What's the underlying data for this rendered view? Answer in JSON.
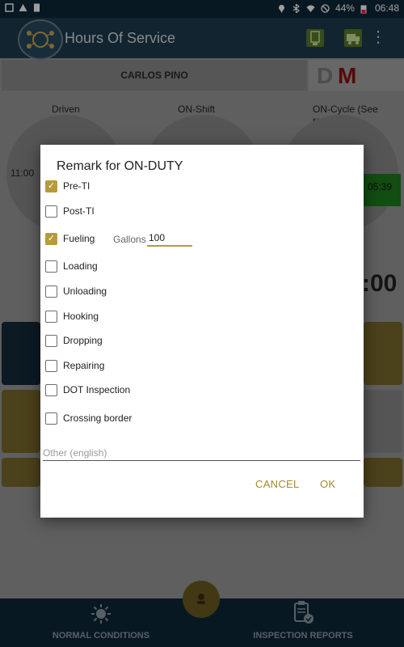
{
  "status_bar": {
    "battery": "44%",
    "time": "06:48"
  },
  "app": {
    "title": "Hours Of Service"
  },
  "driver": {
    "name": "CARLOS PINO",
    "mode_d": "D",
    "mode_m": "M"
  },
  "clocks": {
    "driven_label": "Driven",
    "onshift_label": "ON-Shift",
    "oncycle_label": "ON-Cycle (See recap)",
    "driven_value": "11:00",
    "oncycle_value": "05:39",
    "big_time": ":00"
  },
  "dialog": {
    "title": "Remark for ON-DUTY",
    "options": [
      {
        "label": "Pre-TI",
        "checked": true
      },
      {
        "label": "Post-TI",
        "checked": false
      },
      {
        "label": "Fueling",
        "checked": true
      },
      {
        "label": "Loading",
        "checked": false
      },
      {
        "label": "Unloading",
        "checked": false
      },
      {
        "label": "Hooking",
        "checked": false
      },
      {
        "label": "Dropping",
        "checked": false
      },
      {
        "label": "Repairing",
        "checked": false
      },
      {
        "label": "DOT Inspection",
        "checked": false
      },
      {
        "label": "Crossing border",
        "checked": false
      }
    ],
    "gallons_label": "Gallons",
    "gallons_value": "100",
    "other_placeholder": "Other (english)",
    "cancel_label": "CANCEL",
    "ok_label": "OK"
  },
  "bottom_nav": {
    "normal_label": "NORMAL CONDITIONS",
    "inspection_label": "INSPECTION REPORTS"
  },
  "colors": {
    "accent": "#b59b3a",
    "app_bar": "#1d3a4d",
    "status_red": "#8a1010"
  }
}
